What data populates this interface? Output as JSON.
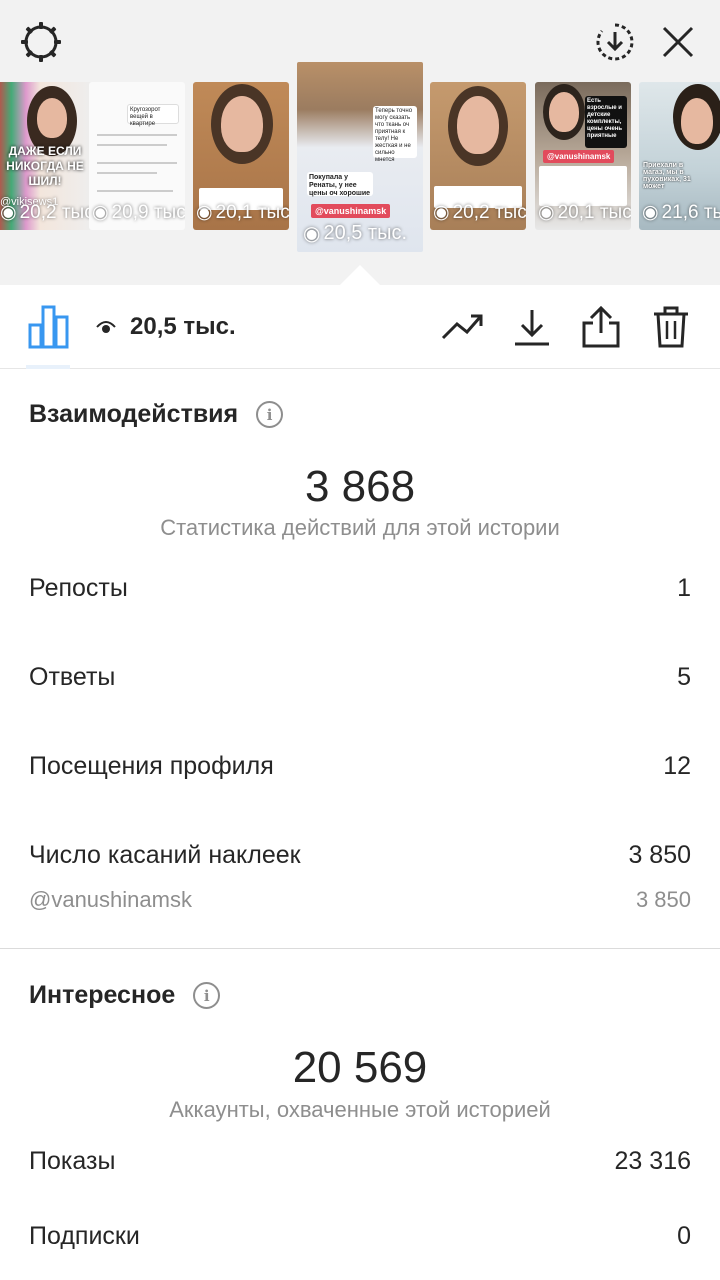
{
  "thumbnails": [
    {
      "views": "20,2 тыс.",
      "caption": "ДАЖЕ ЕСЛИ НИКОГДА НЕ ШИЛ!",
      "mention": "@vikisews1"
    },
    {
      "views": "20,9 тыс.",
      "caption": "Кругозорот вещей в квартире"
    },
    {
      "views": "20,1 тыс.",
      "caption": ""
    },
    {
      "views": "20,5 тыс.",
      "caption": "Покупала у Ренаты, у нее цены оч хорошие",
      "mention": "@vanushinamsk",
      "side_text": "Теперь точно могу сказать что ткань оч приятная к телу! Не жесткая и не сильно мнется"
    },
    {
      "views": "20,2 тыс.",
      "caption": ""
    },
    {
      "views": "20,1 тыс.",
      "caption": "Есть взрослые и детские комплекты, цены очень приятные",
      "mention": "@vanushinamsk"
    },
    {
      "views": "21,6 тыс.",
      "caption": "Приехали в магаз, мы в пуховиках, 31 может"
    }
  ],
  "toolbar": {
    "views": "20,5 тыс."
  },
  "interactions": {
    "title": "Взаимодействия",
    "total": "3 868",
    "caption": "Статистика действий для этой истории",
    "rows": [
      {
        "label": "Репосты",
        "value": "1"
      },
      {
        "label": "Ответы",
        "value": "5"
      },
      {
        "label": "Посещения профиля",
        "value": "12"
      },
      {
        "label": "Число касаний наклеек",
        "value": "3 850"
      }
    ],
    "sticker": {
      "label": "@vanushinamsk",
      "value": "3 850"
    }
  },
  "discovery": {
    "title": "Интересное",
    "total": "20 569",
    "caption": "Аккаунты, охваченные этой историей",
    "rows": [
      {
        "label": "Показы",
        "value": "23 316"
      },
      {
        "label": "Подписки",
        "value": "0"
      }
    ]
  },
  "info_glyph": "i",
  "colors": {
    "accent": "#3897f0",
    "text": "#262626",
    "muted": "#8e8e8e",
    "mention_tag": "#e24b5c"
  }
}
